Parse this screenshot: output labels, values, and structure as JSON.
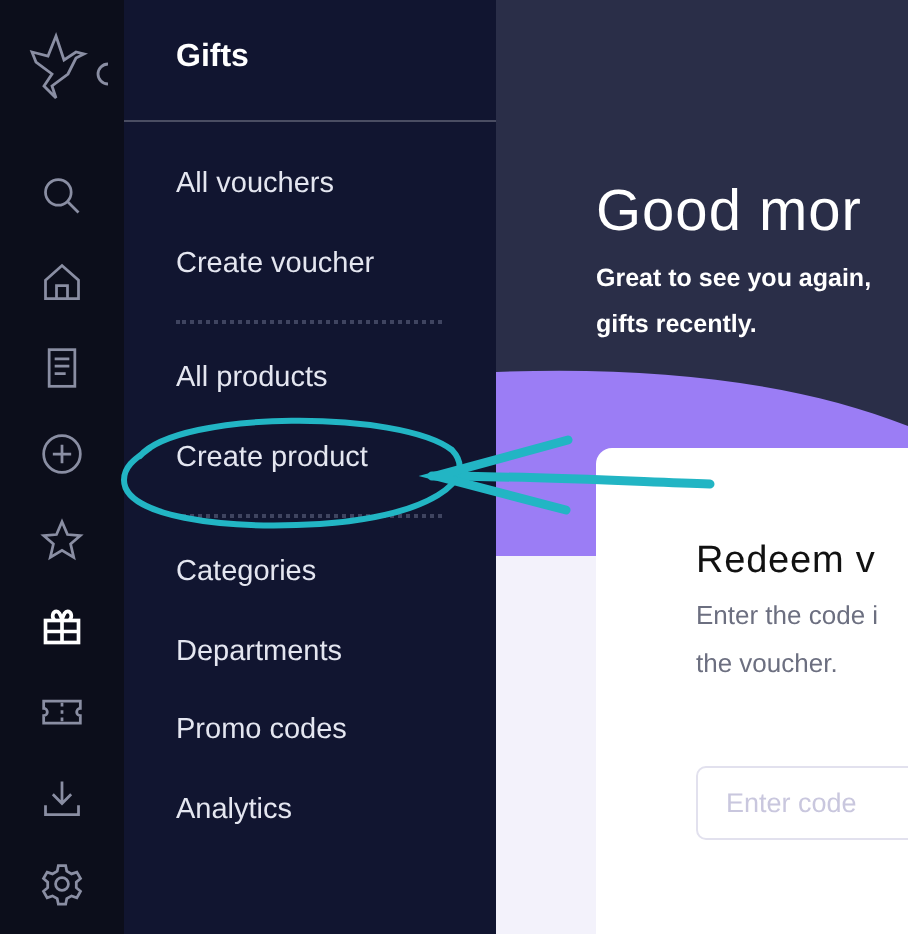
{
  "rail": {
    "items": [
      {
        "kind": "search",
        "selected": false
      },
      {
        "kind": "home",
        "selected": false
      },
      {
        "kind": "document",
        "selected": false
      },
      {
        "kind": "plus",
        "selected": false
      },
      {
        "kind": "star",
        "selected": false
      },
      {
        "kind": "gift",
        "selected": true
      },
      {
        "kind": "ticket",
        "selected": false
      },
      {
        "kind": "download",
        "selected": false
      },
      {
        "kind": "settings",
        "selected": false
      }
    ]
  },
  "submenu": {
    "title": "Gifts",
    "groups": [
      {
        "items": [
          "All vouchers",
          "Create voucher"
        ]
      },
      {
        "items": [
          "All products",
          "Create product"
        ]
      },
      {
        "items": [
          "Categories",
          "Departments",
          "Promo codes",
          "Analytics"
        ]
      }
    ]
  },
  "main": {
    "greeting": "Good mor",
    "subtitle_lines": [
      "Great to see you again,",
      "gifts recently."
    ],
    "card": {
      "title": "Redeem v",
      "description_lines": [
        "Enter the code i",
        "the voucher."
      ],
      "input": {
        "placeholder": "Enter code"
      }
    }
  }
}
